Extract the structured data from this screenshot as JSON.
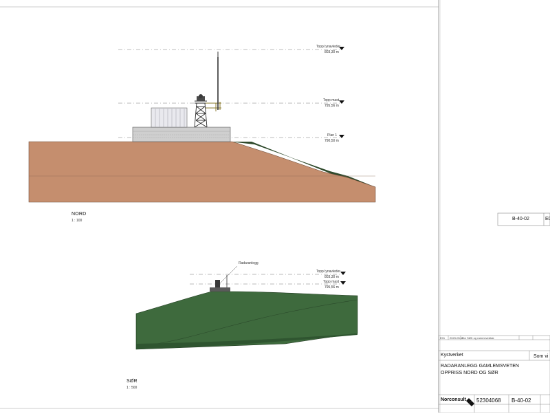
{
  "nord": {
    "title": "NORD",
    "scale": "1 : 100",
    "levels": [
      {
        "name": "Topp lynavleder",
        "value": "803,30 m"
      },
      {
        "name": "Topp mast",
        "value": "795,56 m"
      },
      {
        "name": "Plan 1",
        "value": "790,50 m"
      }
    ]
  },
  "sor": {
    "title": "SØR",
    "scale": "1 : 500",
    "tag": "Radaranlegg",
    "levels": [
      {
        "name": "Topp lynavleder",
        "value": "803,30 m"
      },
      {
        "name": "Topp mast",
        "value": "795,56 m"
      }
    ]
  },
  "right_panel": {
    "drawing_no": "B-40-02",
    "revision_partial": "E0",
    "scale_partial": "Som vi"
  },
  "title_block": {
    "revision_row": {
      "rev": "E01",
      "date": "2023-05-16",
      "description": "For SØK og rammevedtak"
    },
    "client": "Kystverket",
    "project": "RADARANLEGG GAMLEMSVETEN",
    "drawing_title": "OPPRISS NORD OG SØR",
    "company": "Norconsult",
    "project_no": "52304068",
    "drawing_no": "B-40-02"
  }
}
